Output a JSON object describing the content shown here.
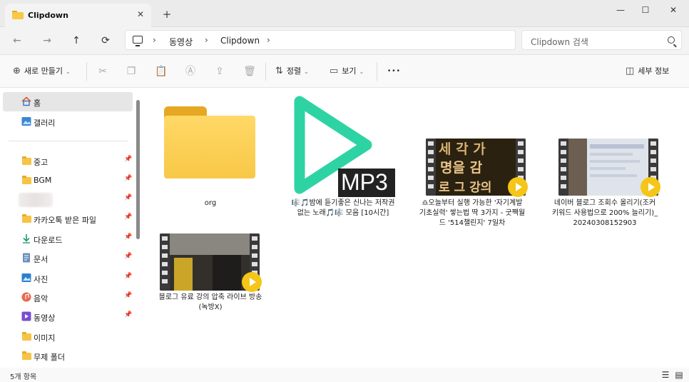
{
  "tab": {
    "title": "Clipdown",
    "close_glyph": "✕",
    "new_tab_glyph": "+"
  },
  "window_controls": {
    "minimize": "—",
    "maximize": "☐",
    "close": "✕"
  },
  "nav": {
    "back": "←",
    "forward": "→",
    "up": "↑",
    "refresh": "⟳"
  },
  "breadcrumb": {
    "sep": "›",
    "items": [
      "동영상",
      "Clipdown"
    ]
  },
  "search": {
    "placeholder": "Clipdown 검색"
  },
  "commands": {
    "new_label": "새로 만들기",
    "sort_label": "정렬",
    "view_label": "보기",
    "more_glyph": "•••",
    "details_label": "세부 정보",
    "chevron": "⌄"
  },
  "sidebar": {
    "top_items": [
      {
        "label": "홈",
        "icon": "home-icon"
      },
      {
        "label": "갤러리",
        "icon": "gallery-icon"
      }
    ],
    "pinned": [
      {
        "label": "중고",
        "icon": "folder-icon"
      },
      {
        "label": "BGM",
        "icon": "folder-icon"
      },
      {
        "label": "",
        "icon": "blurred"
      },
      {
        "label": "카카오톡 받은 파일",
        "icon": "folder-icon"
      },
      {
        "label": "다운로드",
        "icon": "download-icon"
      },
      {
        "label": "문서",
        "icon": "document-icon"
      },
      {
        "label": "사진",
        "icon": "pictures-icon"
      },
      {
        "label": "음악",
        "icon": "music-icon"
      },
      {
        "label": "동영상",
        "icon": "video-icon"
      },
      {
        "label": "이미지",
        "icon": "folder-icon"
      },
      {
        "label": "무제 폴더",
        "icon": "folder-icon"
      }
    ],
    "pin_glyph": "📌"
  },
  "files": [
    {
      "label": "org",
      "type": "folder"
    },
    {
      "label": "🎼🎵밤에 듣기좋은 신나는 저작권 없는 노래🎵🎼 모음 [10시간]",
      "type": "mp3",
      "badge": "MP3"
    },
    {
      "label": "♎오늘부터 실행 가능한 '자기계발 기초실력' 쌓는법 딱 3가지 - 굿짹월드 '514챌린지' 7일차",
      "type": "video",
      "thumb_text": [
        "세 각 가",
        "명을 감",
        "로 그 강의"
      ]
    },
    {
      "label": "네이버 블로그 조회수 올리기(조커 키워드 사용법으로 200% 늘리기)_20240308152903",
      "type": "video"
    },
    {
      "label": "블로그 유료 강의 압축 라이브 방송(녹방X)",
      "type": "video"
    }
  ],
  "status": {
    "count": "5개 항목",
    "details_view_glyph": "☰",
    "tiles_view_glyph": "▤"
  },
  "colors": {
    "mp3_accent": "#2ed3a4",
    "play_badge": "#f5c518",
    "folder": "#f8c847"
  }
}
